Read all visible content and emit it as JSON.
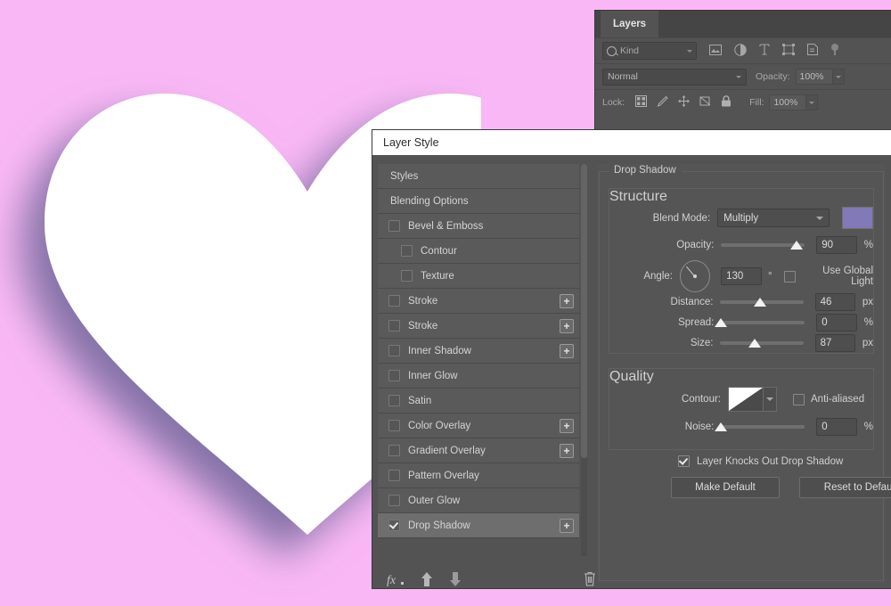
{
  "canvas": {
    "background_color": "#f9b8f5",
    "artwork_name": "white-heart-with-drop-shadow",
    "shadow_color": "#7d73ab"
  },
  "layers_panel": {
    "tab_label": "Layers",
    "filter": {
      "placeholder": "Kind",
      "icon": "search-icon"
    },
    "filter_icons": [
      "image-filter-icon",
      "adjustment-filter-icon",
      "type-filter-icon",
      "shape-filter-icon",
      "smart-object-filter-icon",
      "filter-toggle-icon"
    ],
    "blend_mode": "Normal",
    "opacity_label": "Opacity:",
    "opacity_value": "100%",
    "lock_label": "Lock:",
    "lock_icons": [
      "lock-transparent-pixels-icon",
      "lock-image-pixels-icon",
      "lock-position-icon",
      "lock-artboard-nesting-icon",
      "lock-all-icon"
    ],
    "fill_label": "Fill:",
    "fill_value": "100%"
  },
  "layer_style": {
    "title": "Layer Style",
    "styles_list": [
      {
        "label": "Styles",
        "type": "plain",
        "checked": false,
        "has_plus": false,
        "active": false
      },
      {
        "label": "Blending Options",
        "type": "plain",
        "checked": false,
        "has_plus": false,
        "active": false
      },
      {
        "label": "Bevel & Emboss",
        "type": "lvl1",
        "checked": false,
        "has_plus": false,
        "active": false
      },
      {
        "label": "Contour",
        "type": "lvl2",
        "checked": false,
        "has_plus": false,
        "active": false
      },
      {
        "label": "Texture",
        "type": "lvl2",
        "checked": false,
        "has_plus": false,
        "active": false
      },
      {
        "label": "Stroke",
        "type": "lvl1",
        "checked": false,
        "has_plus": true,
        "active": false
      },
      {
        "label": "Stroke",
        "type": "lvl1",
        "checked": false,
        "has_plus": true,
        "active": false
      },
      {
        "label": "Inner Shadow",
        "type": "lvl1",
        "checked": false,
        "has_plus": true,
        "active": false
      },
      {
        "label": "Inner Glow",
        "type": "lvl1",
        "checked": false,
        "has_plus": false,
        "active": false
      },
      {
        "label": "Satin",
        "type": "lvl1",
        "checked": false,
        "has_plus": false,
        "active": false
      },
      {
        "label": "Color Overlay",
        "type": "lvl1",
        "checked": false,
        "has_plus": true,
        "active": false
      },
      {
        "label": "Gradient Overlay",
        "type": "lvl1",
        "checked": false,
        "has_plus": true,
        "active": false
      },
      {
        "label": "Pattern Overlay",
        "type": "lvl1",
        "checked": false,
        "has_plus": false,
        "active": false
      },
      {
        "label": "Outer Glow",
        "type": "lvl1",
        "checked": false,
        "has_plus": false,
        "active": false
      },
      {
        "label": "Drop Shadow",
        "type": "lvl1",
        "checked": true,
        "has_plus": true,
        "active": true
      }
    ],
    "footer_icons": [
      "fx-icon",
      "move-up-icon",
      "move-down-icon",
      "trash-icon"
    ],
    "panel": {
      "section_title": "Drop Shadow",
      "structure": {
        "legend": "Structure",
        "blend_mode_label": "Blend Mode:",
        "blend_mode_value": "Multiply",
        "shadow_color": "#8179b8",
        "opacity_label": "Opacity:",
        "opacity_value": "90",
        "opacity_unit": "%",
        "opacity_pct": 90,
        "angle_label": "Angle:",
        "angle_value": "130",
        "angle_unit": "°",
        "global_light_label": "Use Global Light",
        "global_light_checked": false,
        "distance_label": "Distance:",
        "distance_value": "46",
        "distance_unit": "px",
        "distance_pct": 48,
        "spread_label": "Spread:",
        "spread_value": "0",
        "spread_unit": "%",
        "spread_pct": 0,
        "size_label": "Size:",
        "size_value": "87",
        "size_unit": "px",
        "size_pct": 41
      },
      "quality": {
        "legend": "Quality",
        "contour_label": "Contour:",
        "contour_preset": "linear-contour-icon",
        "anti_aliased_label": "Anti-aliased",
        "anti_aliased_checked": false,
        "noise_label": "Noise:",
        "noise_value": "0",
        "noise_unit": "%",
        "noise_pct": 0
      },
      "knockout_label": "Layer Knocks Out Drop Shadow",
      "knockout_checked": true,
      "make_default_label": "Make Default",
      "reset_default_label": "Reset to Default"
    }
  }
}
